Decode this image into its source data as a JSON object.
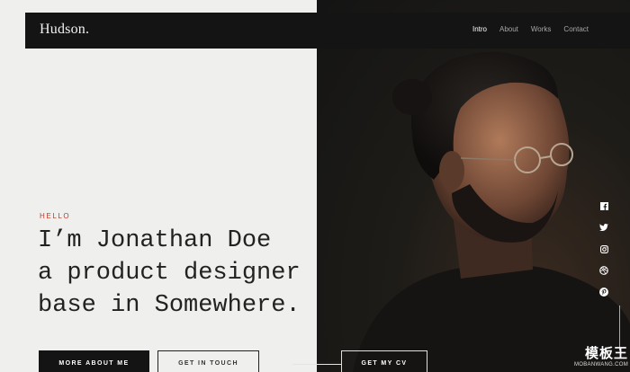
{
  "header": {
    "logo": "Hudson.",
    "nav": [
      {
        "label": "Intro",
        "active": true
      },
      {
        "label": "About",
        "active": false
      },
      {
        "label": "Works",
        "active": false
      },
      {
        "label": "Contact",
        "active": false
      }
    ]
  },
  "hero": {
    "greeting": "HELLO",
    "lines": [
      "I’m Jonathan Doe",
      "a product designer",
      "base in Somewhere."
    ]
  },
  "buttons": {
    "more_about": "MORE ABOUT ME",
    "get_in_touch": "GET IN TOUCH",
    "get_cv": "GET MY CV"
  },
  "social": [
    "facebook-icon",
    "twitter-icon",
    "instagram-icon",
    "dribbble-icon",
    "pinterest-icon"
  ],
  "watermark": {
    "main": "模板王",
    "sub": "MOBANWANG.COM"
  },
  "colors": {
    "accent": "#c0392b",
    "dark": "#141414",
    "light": "#efefed"
  }
}
